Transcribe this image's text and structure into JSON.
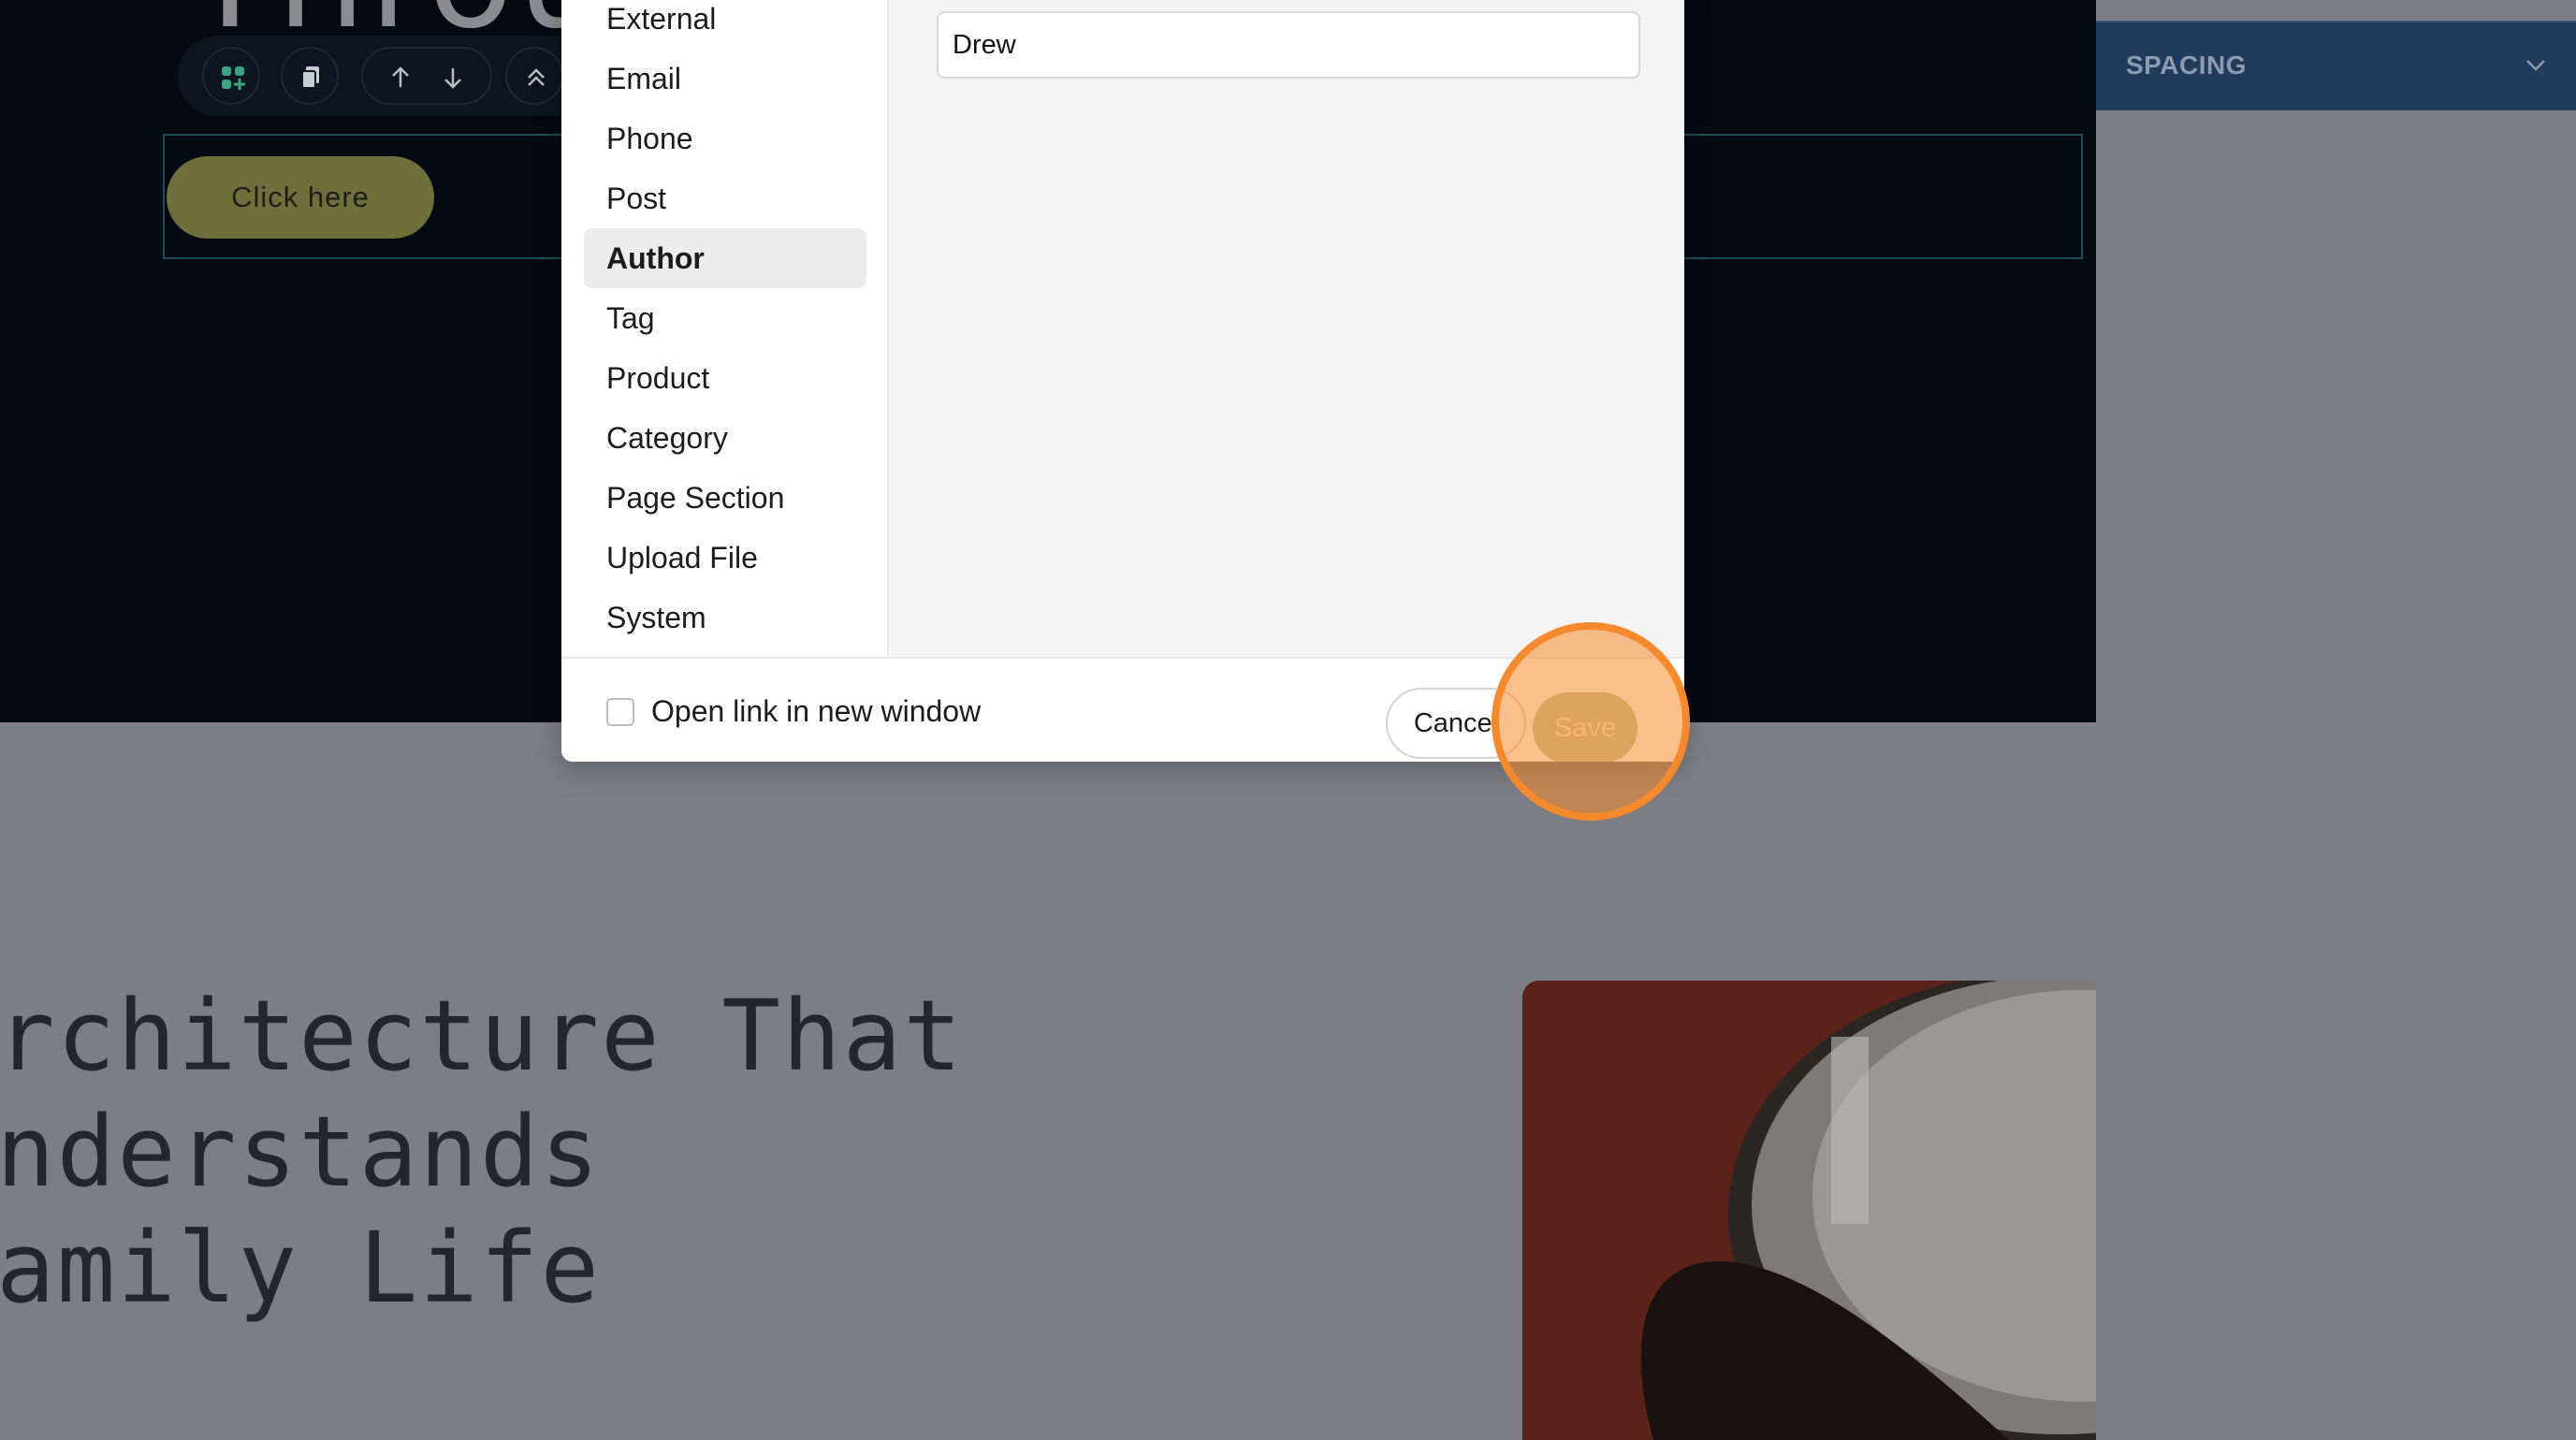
{
  "page": {
    "hero_title_fragment": "Throu",
    "cta_button": "Click here",
    "section_heading": "rchitecture That\nnderstands\namily Life"
  },
  "toolbar": {
    "icons": [
      "add-block-icon",
      "duplicate-icon",
      "move-up-icon",
      "move-down-icon",
      "collapse-icon"
    ]
  },
  "side_panel": {
    "section_label": "SPACING"
  },
  "link_dialog": {
    "types": [
      "External",
      "Email",
      "Phone",
      "Post",
      "Author",
      "Tag",
      "Product",
      "Category",
      "Page Section",
      "Upload File",
      "System"
    ],
    "selected_type": "Author",
    "author_value": "Drew",
    "new_window_label": "Open link in new window",
    "new_window_checked": false,
    "cancel_label": "Cancel",
    "save_label": "Save"
  },
  "colors": {
    "highlight": "#f58a2c",
    "cta_button": "#6f6f3c",
    "side_header": "#213b5c"
  }
}
